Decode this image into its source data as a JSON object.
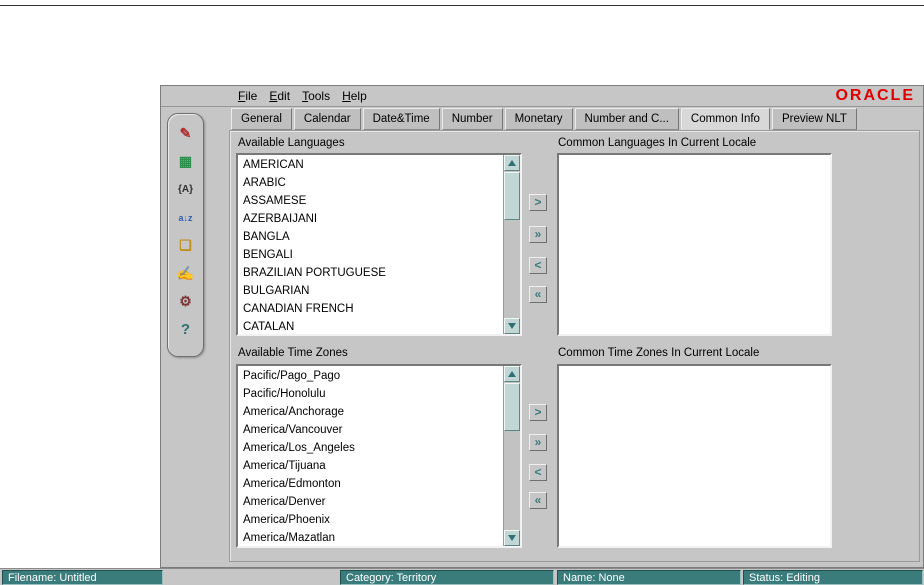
{
  "colors": {
    "accent_teal": "#3a7c7c",
    "oracle_red": "#e00000",
    "window_bg": "#c6c6c6"
  },
  "logo": "ORACLE",
  "menu": {
    "items": [
      "File",
      "Edit",
      "Tools",
      "Help"
    ]
  },
  "tabs": [
    {
      "label": "General"
    },
    {
      "label": "Calendar"
    },
    {
      "label": "Date&Time"
    },
    {
      "label": "Number"
    },
    {
      "label": "Monetary"
    },
    {
      "label": "Number and C..."
    },
    {
      "label": "Common Info",
      "selected": true
    },
    {
      "label": "Preview NLT"
    }
  ],
  "toolbar": {
    "icons": [
      {
        "name": "new-language-icon",
        "glyph": "✎",
        "color": "#b03030",
        "size": 14
      },
      {
        "name": "new-territory-icon",
        "glyph": "▦",
        "color": "#2f8f4f",
        "size": 14
      },
      {
        "name": "new-charset-icon",
        "glyph": "{A}",
        "color": "#303030",
        "size": 10
      },
      {
        "name": "new-sort-icon",
        "glyph": "a↓z",
        "color": "#2b5fb0",
        "size": 9
      },
      {
        "name": "open-file-icon",
        "glyph": "❏",
        "color": "#c09020",
        "size": 14
      },
      {
        "name": "save-file-icon",
        "glyph": "✍",
        "color": "#c09020",
        "size": 14
      },
      {
        "name": "preview-tool-icon",
        "glyph": "⚙",
        "color": "#7a3535",
        "size": 14
      },
      {
        "name": "help-icon",
        "glyph": "?",
        "color": "#2f7070",
        "size": 15
      }
    ]
  },
  "transfer": {
    "move_right": ">",
    "move_all_right": "»",
    "move_left": "<",
    "move_all_left": "«"
  },
  "languages": {
    "available_label": "Available Languages",
    "common_label": "Common Languages In Current Locale",
    "available_items": [
      "AMERICAN",
      "ARABIC",
      "ASSAMESE",
      "AZERBAIJANI",
      "BANGLA",
      "BENGALI",
      "BRAZILIAN PORTUGUESE",
      "BULGARIAN",
      "CANADIAN FRENCH",
      "CATALAN"
    ],
    "common_items": []
  },
  "timezones": {
    "available_label": "Available Time Zones",
    "common_label": "Common Time Zones In Current Locale",
    "available_items": [
      "Pacific/Pago_Pago",
      "Pacific/Honolulu",
      "America/Anchorage",
      "America/Vancouver",
      "America/Los_Angeles",
      "America/Tijuana",
      "America/Edmonton",
      "America/Denver",
      "America/Phoenix",
      "America/Mazatlan"
    ],
    "common_items": []
  },
  "statusbar": {
    "filename": "Filename: Untitled",
    "category": "Category: Territory",
    "name": "Name: None",
    "status": "Status: Editing"
  }
}
